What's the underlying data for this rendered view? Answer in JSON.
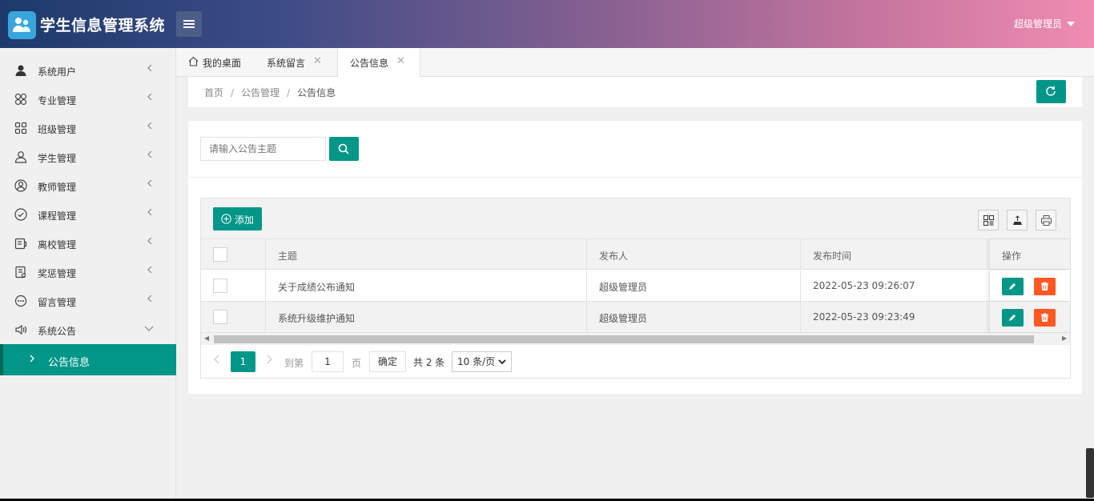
{
  "app": {
    "title": "学生信息管理系统",
    "user": "超级管理员"
  },
  "sidebar": {
    "items": [
      {
        "label": "系统用户",
        "icon": "user-icon"
      },
      {
        "label": "专业管理",
        "icon": "clover-icon"
      },
      {
        "label": "班级管理",
        "icon": "grid-icon"
      },
      {
        "label": "学生管理",
        "icon": "person-icon"
      },
      {
        "label": "教师管理",
        "icon": "user-circle-icon"
      },
      {
        "label": "课程管理",
        "icon": "check-circle-icon"
      },
      {
        "label": "离校管理",
        "icon": "wallet-icon"
      },
      {
        "label": "奖惩管理",
        "icon": "document-icon"
      },
      {
        "label": "留言管理",
        "icon": "chat-icon"
      },
      {
        "label": "系统公告",
        "icon": "speaker-icon",
        "expanded": true
      }
    ],
    "active_sub": "公告信息"
  },
  "tabs": [
    {
      "label": "我的桌面",
      "icon": "home-icon"
    },
    {
      "label": "系统留言",
      "closable": true
    },
    {
      "label": "公告信息",
      "closable": true,
      "active": true
    }
  ],
  "breadcrumb": {
    "home": "首页",
    "section": "公告管理",
    "current": "公告信息",
    "sep": "/"
  },
  "search": {
    "placeholder": "请输入公告主题"
  },
  "toolbar": {
    "add_label": "添加"
  },
  "table": {
    "headers": [
      "主题",
      "发布人",
      "发布时间",
      "操作"
    ],
    "rows": [
      {
        "title": "关于成绩公布通知",
        "publisher": "超级管理员",
        "time": "2022-05-23 09:26:07"
      },
      {
        "title": "系统升级维护通知",
        "publisher": "超级管理员",
        "time": "2022-05-23 09:23:49"
      }
    ]
  },
  "pager": {
    "current": "1",
    "goto_label": "到第",
    "goto_value": "1",
    "page_label": "页",
    "confirm": "确定",
    "total": "共 2 条",
    "page_size": "10 条/页"
  },
  "colors": {
    "primary": "#009688",
    "danger": "#ff5722"
  }
}
